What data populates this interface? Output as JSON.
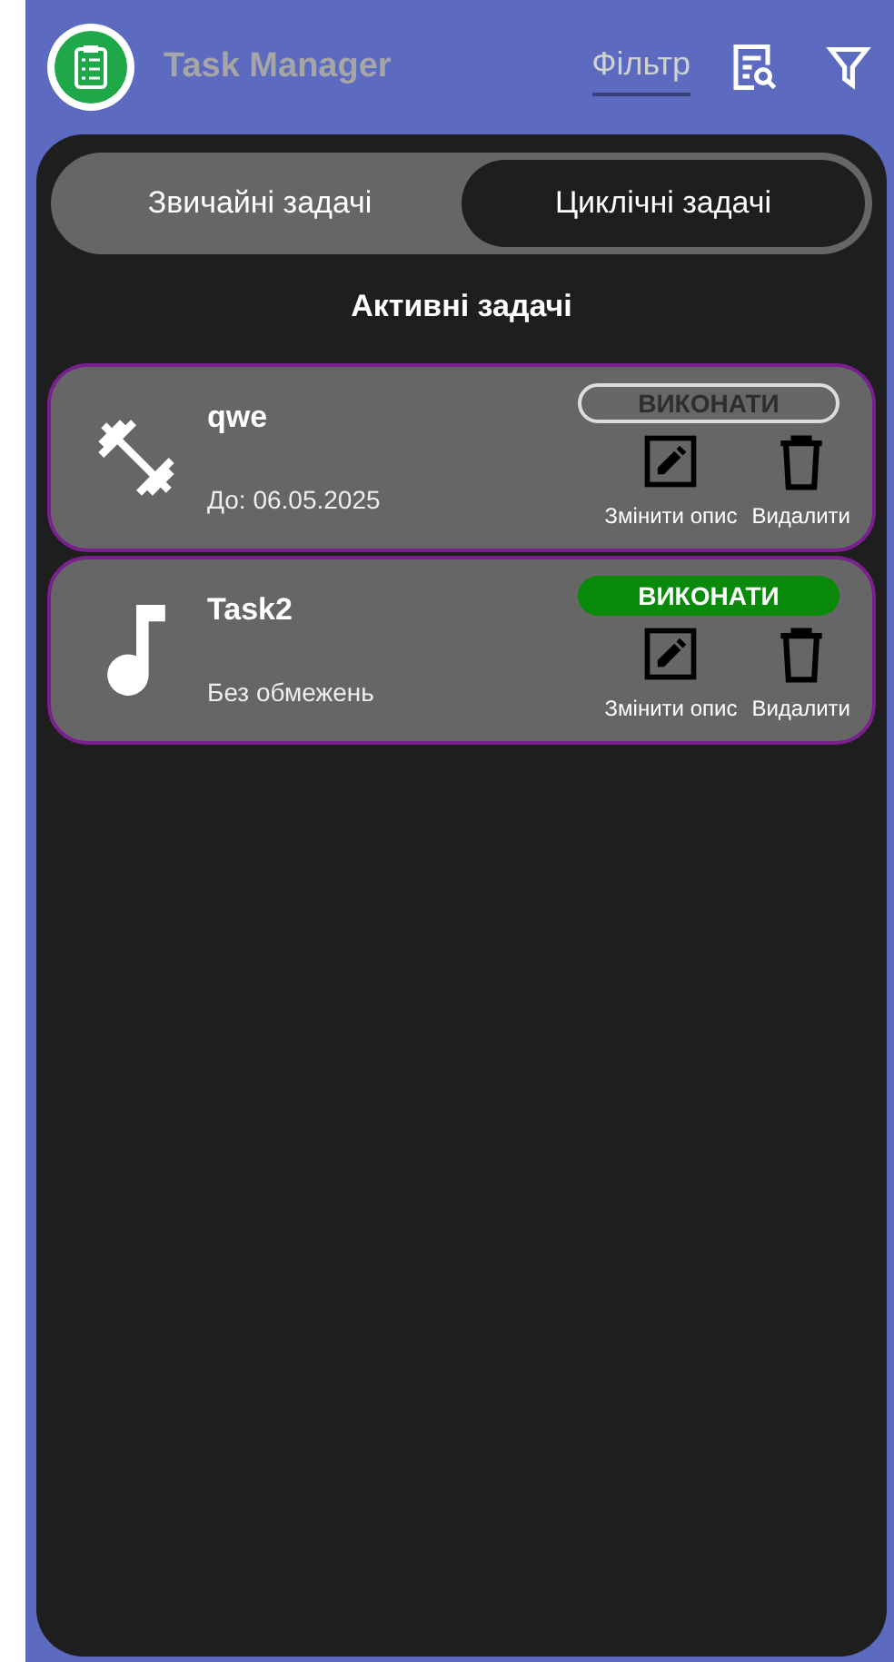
{
  "app_bar": {
    "title": "Task Manager",
    "filter_link": "Фільтр"
  },
  "tabs": [
    {
      "label": "Звичайні задачі",
      "selected": false
    },
    {
      "label": "Циклічні задачі",
      "selected": true
    }
  ],
  "section_title": "Активні задачі",
  "tasks": [
    {
      "kind": "dumbbell",
      "title": "qwe",
      "deadline": "До: 06.05.2025",
      "complete_label": "ВИКОНАТИ",
      "disabled": true,
      "edit_label": "Змінити опис",
      "delete_label": "Видалити"
    },
    {
      "kind": "music",
      "title": "Task2",
      "deadline": "Без обмежень",
      "complete_label": "ВИКОНАТИ",
      "disabled": false,
      "edit_label": "Змінити опис",
      "delete_label": "Видалити"
    }
  ]
}
